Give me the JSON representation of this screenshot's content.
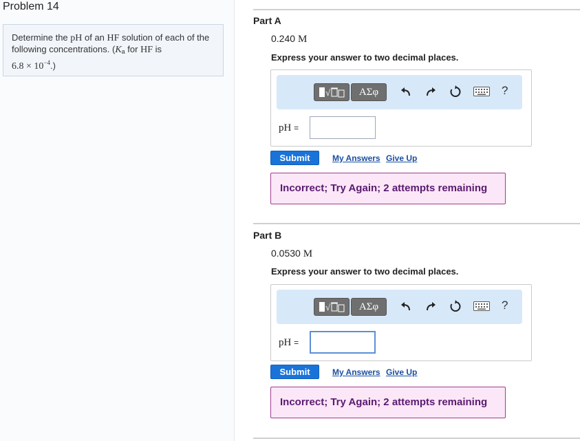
{
  "problem": {
    "title": "Problem 14",
    "text_1": "Determine the ",
    "ph": "pH",
    "text_2": " of an ",
    "hf": "HF",
    "text_3": " solution of each of the following concentrations. (",
    "ka": "K",
    "ka_sub": "a",
    "text_4": " for ",
    "hf2": "HF",
    "text_5": " is",
    "ka_value": "6.8 × 10",
    "ka_exp": "−4",
    "text_6": ".)"
  },
  "parts": [
    {
      "title": "Part A",
      "conc_value": "0.240",
      "conc_unit": "M",
      "instruction": "Express your answer to two decimal places.",
      "toolbar": {
        "greek_label": "ΑΣφ",
        "help_label": "?"
      },
      "ph_label": "pH",
      "eq_label": "=",
      "answer_value": "",
      "submit_label": "Submit",
      "my_answers_label": "My Answers",
      "give_up_label": "Give Up",
      "feedback": "Incorrect; Try Again; 2 attempts remaining"
    },
    {
      "title": "Part B",
      "conc_value": "0.0530",
      "conc_unit": "M",
      "instruction": "Express your answer to two decimal places.",
      "toolbar": {
        "greek_label": "ΑΣφ",
        "help_label": "?"
      },
      "ph_label": "pH",
      "eq_label": "=",
      "answer_value": "",
      "submit_label": "Submit",
      "my_answers_label": "My Answers",
      "give_up_label": "Give Up",
      "feedback": "Incorrect; Try Again; 2 attempts remaining"
    }
  ],
  "colors": {
    "submit": "#1a73d9",
    "toolbar_bg": "#d7e8f9",
    "feedback_bg": "#fbe7f7",
    "feedback_border": "#a23a8e",
    "link": "#1a4fa0"
  },
  "icons": [
    "templates-icon",
    "greek-symbols-icon",
    "undo-icon",
    "redo-icon",
    "reset-icon",
    "keyboard-icon",
    "help-icon"
  ]
}
